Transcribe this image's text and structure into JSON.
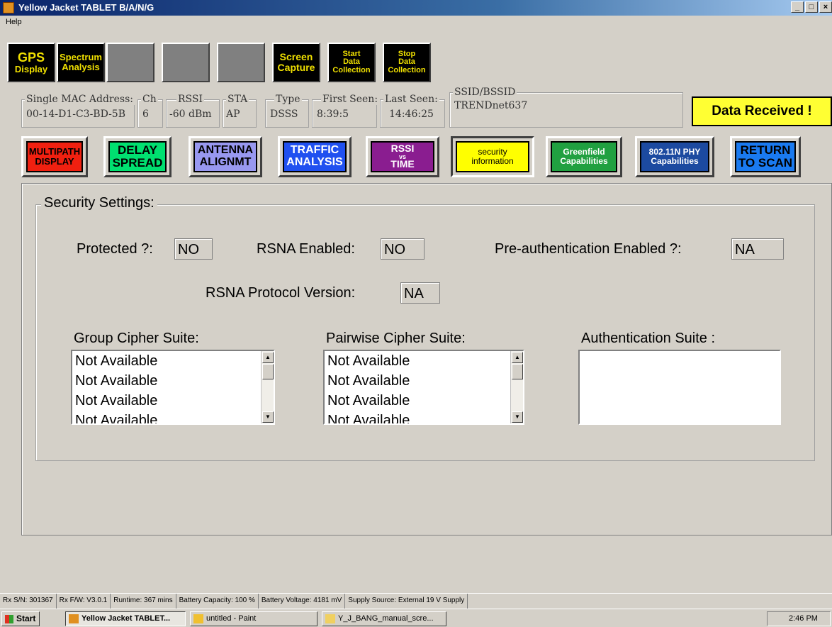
{
  "window": {
    "title": "Yellow Jacket TABLET B/A/N/G",
    "minimize": "_",
    "maximize": "□",
    "close": "×"
  },
  "menu": {
    "help": "Help"
  },
  "toolbar": {
    "gps": [
      "GPS",
      "Display"
    ],
    "spectrum": [
      "Spectrum",
      "Analysis"
    ],
    "screen_capture": [
      "Screen",
      "Capture"
    ],
    "start_collection": [
      "Start",
      "Data",
      "Collection"
    ],
    "stop_collection": [
      "Stop",
      "Data",
      "Collection"
    ]
  },
  "info": {
    "mac_label": "Single MAC Address:",
    "mac_value": "00-14-D1-C3-BD-5B",
    "ch_label": "Ch",
    "ch_value": "6",
    "rssi_label": "RSSI",
    "rssi_value": "-60  dBm",
    "sta_label": "STA",
    "sta_value": "AP",
    "type_label": "Type",
    "type_value": "DSSS",
    "first_label": "First Seen:",
    "first_value": "8:39:5",
    "last_label": "Last Seen:",
    "last_value": "14:46:25",
    "ssid_label": "SSID/BSSID",
    "ssid_value": "TRENDnet637",
    "data_received": "Data Received !"
  },
  "nav": {
    "multipath": [
      "MULTIPATH",
      "DISPLAY"
    ],
    "delay": [
      "DELAY",
      "SPREAD"
    ],
    "antenna": [
      "ANTENNA",
      "ALIGNMT"
    ],
    "traffic": [
      "TRAFFIC",
      "ANALYSIS"
    ],
    "rssi": [
      "RSSI",
      "vs",
      "TIME"
    ],
    "security": [
      "security",
      "information"
    ],
    "greenfield": [
      "Greenfield",
      "Capabilities"
    ],
    "phy": [
      "802.11N PHY",
      "Capabilities"
    ],
    "return": [
      "RETURN",
      "TO SCAN"
    ]
  },
  "security": {
    "title": "Security Settings:",
    "protected_label": "Protected ?:",
    "protected_value": "NO",
    "rsna_label": "RSNA Enabled:",
    "rsna_value": "NO",
    "preauth_label": "Pre-authentication Enabled ?:",
    "preauth_value": "NA",
    "version_label": "RSNA Protocol Version:",
    "version_value": "NA",
    "group_label": "Group Cipher Suite:",
    "group_items": [
      "Not Available",
      "Not Available",
      "Not Available",
      "Not Available"
    ],
    "pairwise_label": "Pairwise Cipher Suite:",
    "pairwise_items": [
      "Not Available",
      "Not Available",
      "Not Available",
      "Not Available"
    ],
    "auth_label": "Authentication Suite :"
  },
  "status": {
    "sn": "Rx S/N: 301367",
    "fw": "Rx F/W: V3.0.1",
    "runtime": "Runtime: 367 mins",
    "capacity": "Battery Capacity: 100 %",
    "voltage": "Battery Voltage: 4181 mV",
    "supply": "Supply Source: External 19 V Supply"
  },
  "taskbar": {
    "start": "Start",
    "task1": "Yellow Jacket TABLET...",
    "task2": "untitled - Paint",
    "task3": "Y_J_BANG_manual_scre...",
    "clock": "2:46 PM"
  }
}
